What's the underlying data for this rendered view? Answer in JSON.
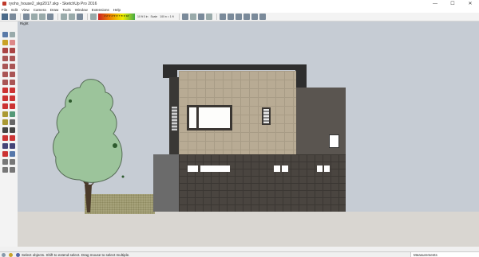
{
  "window": {
    "title": "ryoho_house2_skp2017.skp - SketchUp Pro 2016"
  },
  "window_controls": {
    "minimize": "—",
    "maximize": "☐",
    "close": "✕"
  },
  "menu": [
    "File",
    "Edit",
    "View",
    "Camera",
    "Draw",
    "Tools",
    "Window",
    "Extensions",
    "Help"
  ],
  "toolbar": {
    "scale_label": "1' 2' 3' 4' 5' 6' 7' 8' 9' 10'",
    "scale_small_1": "10 ft 0 in",
    "scale_small_2": "Scale",
    "scale_small_3": "1/8 in = 1 ft"
  },
  "viewport": {
    "view_label": "Right"
  },
  "status": {
    "text": "Select objects. Shift to extend select. Drag mouse to select multiple.",
    "measurements_label": "Measurements"
  },
  "colors": {
    "sky": "#c6ccd4",
    "ground": "#d9d6d1",
    "upper_facade": "#b8ab94",
    "lower_facade": "#4a4540",
    "tree": "#9cc49b"
  }
}
